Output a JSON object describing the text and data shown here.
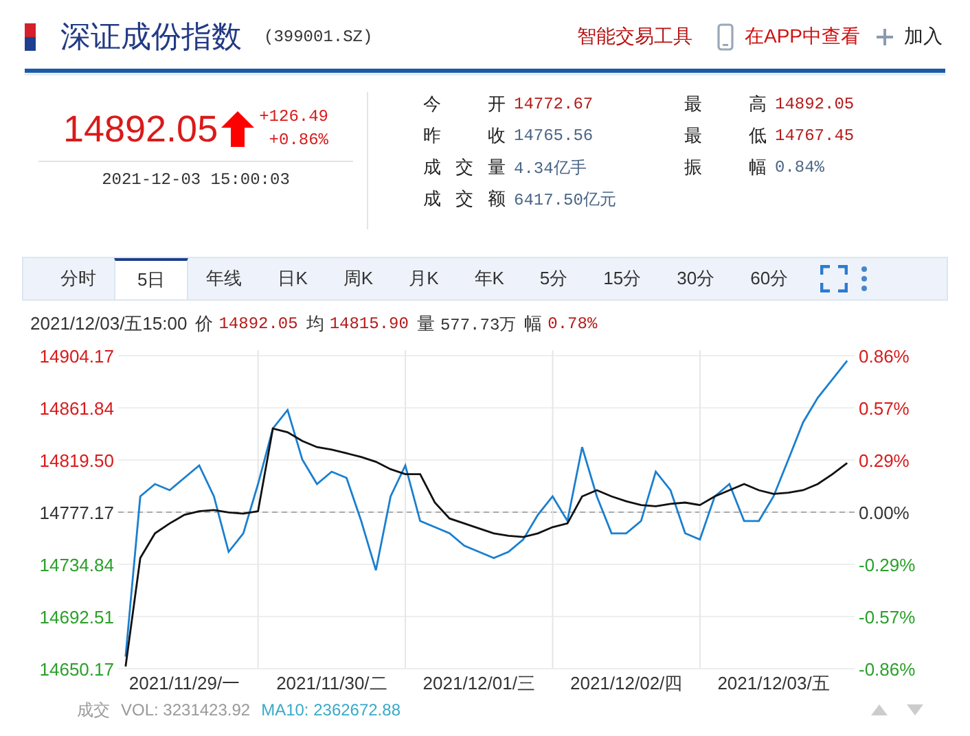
{
  "header": {
    "title": "深证成份指数",
    "code": "(399001.SZ)",
    "links": [
      {
        "label": "智能交易工具",
        "kind": "text"
      },
      {
        "label": "在APP中查看",
        "kind": "phone"
      },
      {
        "label": "加入",
        "kind": "plus"
      }
    ]
  },
  "quote": {
    "price": "14892.05",
    "kind": "up",
    "change": "+126.49",
    "change_pct": "+0.86%",
    "datetime": "2021-12-03 15:00:03"
  },
  "stats": [
    {
      "label": "今 开",
      "value": "14772.67",
      "color": "#b51a1a"
    },
    {
      "label": "最 高",
      "value": "14892.05",
      "color": "#b51a1a"
    },
    {
      "label": "昨 收",
      "value": "14765.56",
      "color": "#4a6585"
    },
    {
      "label": "最 低",
      "value": "14767.45",
      "color": "#b51a1a"
    },
    {
      "label": "成交量",
      "value": "4.34亿手",
      "color": "#4a6585"
    },
    {
      "label": "振 幅",
      "value": "0.84%",
      "color": "#4a6585"
    },
    {
      "label": "成交额",
      "value": "6417.50亿元",
      "color": "#4a6585"
    }
  ],
  "tabs": [
    {
      "label": "分时",
      "selected": false
    },
    {
      "label": "5日",
      "selected": true
    },
    {
      "label": "年线",
      "selected": false
    },
    {
      "label": "日K",
      "selected": false
    },
    {
      "label": "周K",
      "selected": false
    },
    {
      "label": "月K",
      "selected": false
    },
    {
      "label": "年K",
      "selected": false
    },
    {
      "label": "5分",
      "selected": false
    },
    {
      "label": "15分",
      "selected": false
    },
    {
      "label": "30分",
      "selected": false
    },
    {
      "label": "60分",
      "selected": false
    }
  ],
  "info": {
    "time": "2021/12/03/五15:00",
    "items": [
      {
        "label": "价",
        "value": "14892.05",
        "color": "#b51a1a"
      },
      {
        "label": "均",
        "value": "14815.90",
        "color": "#b51a1a"
      },
      {
        "label": "量",
        "value": "577.73万",
        "color": "#333333"
      },
      {
        "label": "幅",
        "value": "0.78%",
        "color": "#b51a1a"
      }
    ]
  },
  "chart": {
    "chart_data": {
      "type": "line",
      "categories": [
        null,
        null,
        null,
        null,
        "2021/11/29/一",
        null,
        null,
        null,
        null,
        null,
        null,
        null,
        null,
        null,
        "2021/11/30/二",
        null,
        null,
        null,
        null,
        null,
        null,
        null,
        null,
        null,
        "2021/12/01/三",
        null,
        null,
        null,
        null,
        null,
        null,
        null,
        null,
        null,
        "2021/12/02/四",
        null,
        null,
        null,
        null,
        null,
        null,
        null,
        null,
        null,
        "2021/12/03/五",
        null,
        null,
        null,
        null,
        null
      ],
      "series": [
        {
          "color": "#1a7fcf",
          "values": [
            14660,
            14790,
            14800,
            14795,
            14805,
            14815,
            14790,
            14745,
            14760,
            14800,
            14845,
            14860,
            14820,
            14800,
            14810,
            14805,
            14770,
            14730,
            14790,
            14815,
            14770,
            14765,
            14760,
            14750,
            14745,
            14740,
            14745,
            14755,
            14775,
            14790,
            14770,
            14830,
            14790,
            14760,
            14760,
            14770,
            14810,
            14795,
            14760,
            14755,
            14790,
            14800,
            14770,
            14770,
            14790,
            14820,
            14850,
            14870,
            14885,
            14900
          ]
        },
        {
          "color": "#111111",
          "values": [
            14652,
            14740,
            14760,
            14768,
            14775,
            14778,
            14779,
            14777,
            14776,
            14778,
            14845,
            14842,
            14835,
            14830,
            14828,
            14825,
            14822,
            14818,
            14812,
            14808,
            14808,
            14785,
            14772,
            14768,
            14764,
            14760,
            14758,
            14757,
            14760,
            14765,
            14768,
            14790,
            14795,
            14790,
            14786,
            14783,
            14782,
            14784,
            14785,
            14783,
            14790,
            14795,
            14800,
            14795,
            14792,
            14793,
            14795,
            14800,
            14808,
            14817
          ]
        }
      ],
      "ylim": [
        14650.17,
        14904.17
      ],
      "grid": true,
      "ref_lines": [
        {
          "axis": "y",
          "value": 14777.17
        }
      ],
      "yticks": [
        {
          "value": 14904.17,
          "label": "14904.17"
        },
        {
          "value": 14861.84,
          "label": "14861.84"
        },
        {
          "value": 14819.5,
          "label": "14819.50"
        },
        {
          "value": 14777.17,
          "label": "14777.17"
        },
        {
          "value": 14734.84,
          "label": "14734.84"
        },
        {
          "value": 14692.51,
          "label": "14692.51"
        },
        {
          "value": 14650.17,
          "label": "14650.17"
        }
      ]
    },
    "percent_labels": [
      "0.86%",
      "0.57%",
      "0.29%",
      "0.00%",
      "-0.29%",
      "-0.57%",
      "-0.86%"
    ]
  },
  "footer": {
    "label": "成交",
    "items": [
      {
        "text": "VOL: 3231423.92",
        "color": "#999999"
      },
      {
        "text": "MA10: 2362672.88",
        "color": "#38a9c9"
      }
    ]
  }
}
